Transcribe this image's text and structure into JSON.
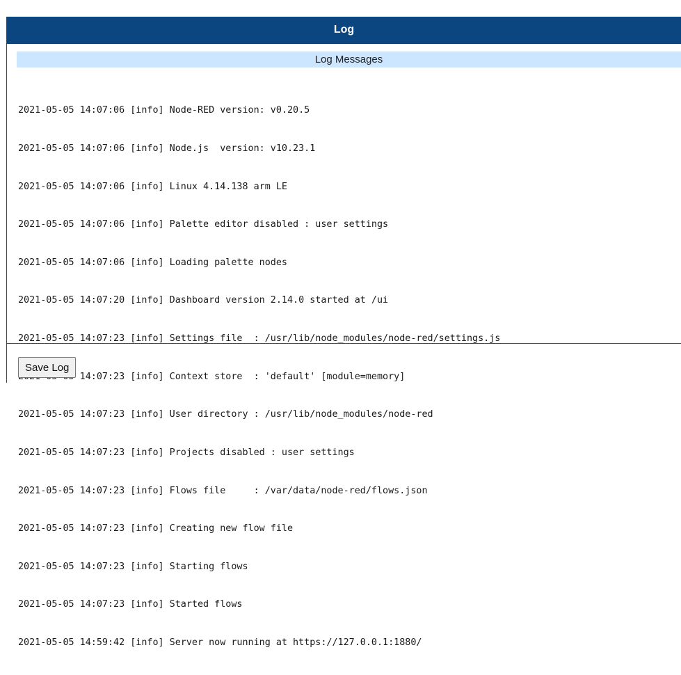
{
  "header": {
    "title": "Log"
  },
  "section": {
    "title": "Log Messages"
  },
  "log": {
    "lines": [
      "2021-05-05 14:07:06 [info] Node-RED version: v0.20.5",
      "2021-05-05 14:07:06 [info] Node.js  version: v10.23.1",
      "2021-05-05 14:07:06 [info] Linux 4.14.138 arm LE",
      "2021-05-05 14:07:06 [info] Palette editor disabled : user settings",
      "2021-05-05 14:07:06 [info] Loading palette nodes",
      "2021-05-05 14:07:20 [info] Dashboard version 2.14.0 started at /ui",
      "2021-05-05 14:07:23 [info] Settings file  : /usr/lib/node_modules/node-red/settings.js",
      "2021-05-05 14:07:23 [info] Context store  : 'default' [module=memory]",
      "2021-05-05 14:07:23 [info] User directory : /usr/lib/node_modules/node-red",
      "2021-05-05 14:07:23 [info] Projects disabled : user settings",
      "2021-05-05 14:07:23 [info] Flows file     : /var/data/node-red/flows.json",
      "2021-05-05 14:07:23 [info] Creating new flow file",
      "2021-05-05 14:07:23 [info] Starting flows",
      "2021-05-05 14:07:23 [info] Started flows",
      "2021-05-05 14:59:42 [info] Server now running at https://127.0.0.1:1880/"
    ]
  },
  "actions": {
    "save_label": "Save Log"
  },
  "colors": {
    "title_bar": "#0b4680",
    "subheader": "#cde6ff",
    "border": "#1f4e87"
  }
}
